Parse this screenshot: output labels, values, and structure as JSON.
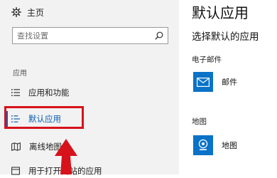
{
  "sidebar": {
    "home_label": "主页",
    "search_placeholder": "查找设置",
    "section_title": "应用",
    "items": [
      {
        "label": "应用和功能",
        "icon": "list-icon"
      },
      {
        "label": "默认应用",
        "icon": "default-apps-icon",
        "active": true
      },
      {
        "label": "离线地图",
        "icon": "map-icon"
      },
      {
        "label": "用于打开网站的应用",
        "icon": "web-app-icon"
      }
    ]
  },
  "main": {
    "title": "默认应用",
    "subtitle": "选择默认的应用",
    "categories": [
      {
        "label": "电子邮件",
        "app": "邮件",
        "icon": "mail-icon"
      },
      {
        "label": "地图",
        "app": "地图",
        "icon": "map-pin-icon"
      }
    ]
  },
  "colors": {
    "accent": "#0a5fb4",
    "app_tile": "#0a72c7",
    "highlight": "#d7121b",
    "sidebar_bg": "#f2f2f2"
  }
}
